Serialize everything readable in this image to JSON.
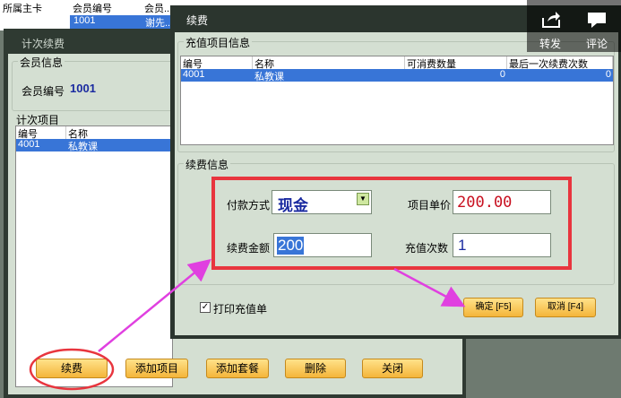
{
  "bg_table": {
    "headers": [
      "所属主卡",
      "会员编号",
      "会员..."
    ],
    "row": [
      "",
      "1001",
      "谢先..."
    ]
  },
  "outer_dialog": {
    "title": "计次续费",
    "member_group": "会员信息",
    "member_label": "会员编号",
    "member_value": "1001",
    "items_group": "计次项目",
    "list_headers": [
      "编号",
      "名称"
    ],
    "list_rows": [
      [
        "4001",
        "私教课"
      ]
    ],
    "buttons": [
      "续费",
      "添加项目",
      "添加套餐",
      "删除",
      "关闭"
    ]
  },
  "inner_dialog": {
    "title": "续费",
    "recharge_group": "充值项目信息",
    "list_headers": [
      "编号",
      "名称",
      "可消费数量",
      "最后一次续费次数"
    ],
    "list_rows": [
      [
        "4001",
        "私教课",
        "0",
        "0"
      ]
    ],
    "renew_group": "续费信息",
    "pay_method_label": "付款方式",
    "pay_method_value": "现金",
    "unit_price_label": "项目单价",
    "unit_price_value": "200.00",
    "amount_label": "续费金额",
    "amount_value": "200",
    "times_label": "充值次数",
    "times_value": "1",
    "print_label": "打印充值单",
    "print_checked": true,
    "ok_label": "确定 [F5]",
    "cancel_label": "取消 [F4]"
  },
  "overlay": {
    "share_label": "转发",
    "comment_label": "评论"
  },
  "colors": {
    "highlight": "#e8353e",
    "arrow": "#e040e0",
    "selection": "#3875d7",
    "button": "#f4b53a"
  }
}
